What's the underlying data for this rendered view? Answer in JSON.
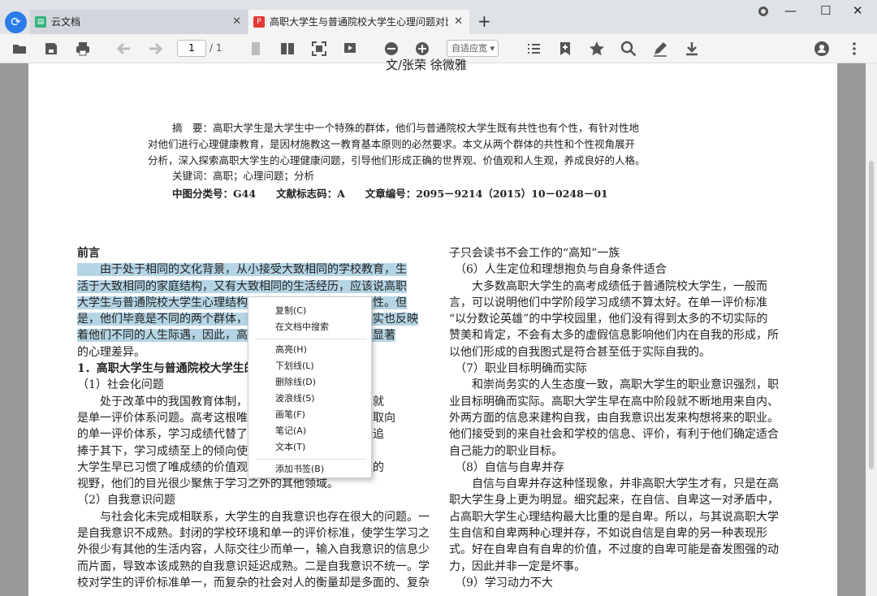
{
  "window": {
    "tabs": [
      {
        "label": "云文档"
      },
      {
        "label": "高职大学生与普通院校大学生心理问题对比..."
      }
    ],
    "new_tab": "+",
    "minimize": "—",
    "maximize": "☐",
    "close": "✕"
  },
  "toolbar": {
    "page_current": "1",
    "page_total": "/ 1",
    "zoom": "自适应宽 ▾"
  },
  "doc": {
    "author": "文/张荣 徐微雅",
    "abstract_lines": [
      "摘　要：高职大学生是大学生中一个特殊的群体，他们与普通院校大学生既有共性也有个性，有针对性地",
      "对他们进行心理健康教育，是因材施教这一教育基本原则的必然要求。本文从两个群体的共性和个性视角展开",
      "分析，深入探索高职大学生的心理健康问题，引导他们形成正确的世界观、价值观和人生观，养成良好的人格。"
    ],
    "keywords": "关键词：高职；心理问题；分析",
    "classification": "中图分类号：G44　　文献标志码：A　　文章编号：2095－9214（2015）10－0248－01",
    "left_lines": [
      {
        "t": "前言",
        "b": true,
        "hl": false
      },
      {
        "t": "　　由于处于相同的文化背景，从小接受大致相同的学校教育，生",
        "hl": true
      },
      {
        "t": "活于大致相同的家庭结构，又有大致相同的生活经历，应该说高职",
        "hl": true
      },
      {
        "t": "大学生与普通院校大学生心理结构上心理问题的共性大于个性。但",
        "hl": true
      },
      {
        "t": "是，他们毕竟是不同的两个群体，从心理问题的表现看，其实也反映",
        "hl": true
      },
      {
        "t": "着他们不同的人生际遇，因此，高职大学生心理问题比较为显著",
        "hl": true
      },
      {
        "t": "的心理差异。",
        "hl": false
      },
      {
        "t": "1．高职大学生与普通院校大学生的心理问题",
        "b": true,
        "hl": false
      },
      {
        "t": "（1）社会化问题",
        "hl": false
      },
      {
        "t": "　　处于改革中的我国教育体制，应试教育仍然是最突出的就",
        "hl": false
      },
      {
        "t": "是单一评价体系问题。高考这根唯一评价标准，以考试成绩取向",
        "hl": false
      },
      {
        "t": "的单一评价体系，学习成绩代替了社会化发展的要求，家长追",
        "hl": false
      },
      {
        "t": "捧于其下，学习成绩至上的倾向使那些只知闭门苦读的",
        "hl": false
      },
      {
        "t": "大学生早已习惯了唯成绩的价值观，因此，不少高职大学生的",
        "hl": false
      },
      {
        "t": "视野，他们的目光很少聚焦于学习之外的其他领域。",
        "hl": false
      },
      {
        "t": "（2）自我意识问题",
        "hl": false
      },
      {
        "t": "　　与社会化未完成相联系，大学生的自我意识也存在很大的问题。一",
        "hl": false
      },
      {
        "t": "是自我意识不成熟。封闭的学校环境和单一的评价标准，使学生学习之",
        "hl": false
      },
      {
        "t": "外很少有其他的生活内容，人际交往少而单一，输入自我意识的信息少",
        "hl": false
      },
      {
        "t": "而片面，导致本该成熟的自我意识延迟成熟。二是自我意识不统一。学",
        "hl": false
      },
      {
        "t": "校对学生的评价标准单一，而复杂的社会对人的衡量却是多面的、复杂",
        "hl": false
      }
    ],
    "right_lines": [
      "子只会读书不会工作的“高知”一族",
      "　（6）人生定位和理想抱负与自身条件适合",
      "　　大多数高职大学生的高考成绩低于普通院校大学生，一般而",
      "言，可以说明他们中学阶段学习成绩不算太好。在单一评价标准",
      "“以分数论英雄”的中学校园里，他们没有得到太多的不切实际的",
      "赞美和肯定，不会有太多的虚假信息影响他们内在自我的形成，所",
      "以他们形成的自我图式是符合甚至低于实际自我的。",
      "　（7）职业目标明确而实际",
      "　　和崇尚务实的人生态度一致，高职大学生的职业意识强烈，职",
      "业目标明确而实际。高职大学生早在高中阶段就不断地用来自内、",
      "外两方面的信息来建构自我，由自我意识出发来构想将来的职业。",
      "他们接受到的来自社会和学校的信息、评价，有利于他们确定适合",
      "自己能力的职业目标。",
      "　（8）自信与自卑并存",
      "　　自信与自卑并存这种怪现象，并非高职大学生才有，只是在高",
      "职大学生身上更为明显。细究起来，在自信、自卑这一对矛盾中，",
      "占高职大学生心理结构最大比重的是自卑。所以，与其说高职大学",
      "生自信和自卑两种心理并存，不如说自信是自卑的另一种表现形",
      "式。好在自卑自有自卑的价值，不过度的自卑可能是奋发图强的动",
      "力，因此并非一定是坏事。",
      "　（9）学习动力不大"
    ]
  },
  "context_menu": {
    "items": [
      "复制(C)",
      "在文档中搜索",
      "高亮(H)",
      "下划线(L)",
      "删除线(D)",
      "波浪线(S)",
      "画笔(F)",
      "笔记(A)",
      "文本(T)",
      "添加书签(B)"
    ]
  }
}
